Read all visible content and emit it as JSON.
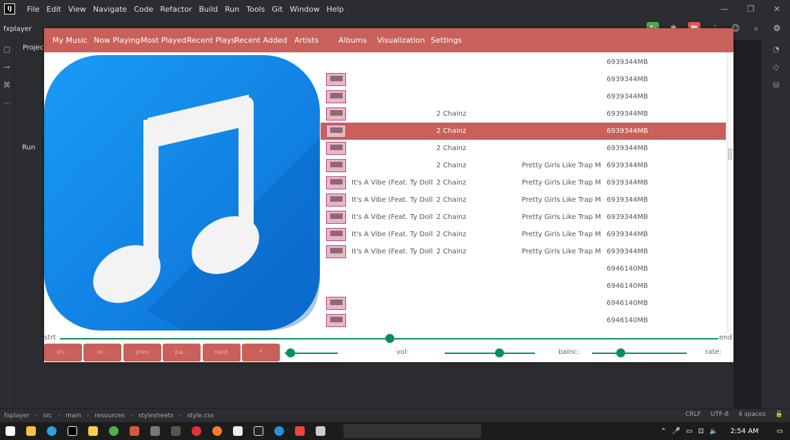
{
  "ide": {
    "logo": "IJ",
    "menu": [
      "File",
      "Edit",
      "View",
      "Navigate",
      "Code",
      "Refactor",
      "Build",
      "Run",
      "Tools",
      "Git",
      "Window",
      "Help"
    ],
    "project_name": "fxplayer",
    "project_panel_label": "Project",
    "run_panel_label": "Run",
    "breadcrumb": [
      "fxplayer",
      "src",
      "main",
      "resources",
      "stylesheets",
      "style.css"
    ],
    "status": {
      "line_sep": "CRLF",
      "encoding": "UTF-8",
      "indent": "4 spaces"
    }
  },
  "player": {
    "nav": [
      "My Music",
      "Now Playing",
      "Most Played",
      "Recent Plays",
      "Recent Added",
      "Artists",
      "Albums",
      "Visualization",
      "Settings"
    ],
    "rows": [
      {
        "thumb": false,
        "title": "",
        "artist": "",
        "album": "",
        "size": "6939344MB",
        "selected": false
      },
      {
        "thumb": true,
        "title": "",
        "artist": "",
        "album": "",
        "size": "6939344MB",
        "selected": false
      },
      {
        "thumb": true,
        "title": "",
        "artist": "",
        "album": "",
        "size": "6939344MB",
        "selected": false
      },
      {
        "thumb": true,
        "title": "",
        "artist": "2 Chainz",
        "album": "",
        "size": "6939344MB",
        "selected": false
      },
      {
        "thumb": true,
        "title": "",
        "artist": "2 Chainz",
        "album": "",
        "size": "6939344MB",
        "selected": true
      },
      {
        "thumb": true,
        "title": "",
        "artist": "2 Chainz",
        "album": "",
        "size": "6939344MB",
        "selected": false
      },
      {
        "thumb": true,
        "title": "",
        "artist": "2 Chainz",
        "album": "Pretty Girls Like Trap M...",
        "size": "6939344MB",
        "selected": false
      },
      {
        "thumb": true,
        "title": "It's A Vibe (Feat. Ty Doll...",
        "artist": "2 Chainz",
        "album": "Pretty Girls Like Trap M...",
        "size": "6939344MB",
        "selected": false
      },
      {
        "thumb": true,
        "title": "It's A Vibe (Feat. Ty Doll...",
        "artist": "2 Chainz",
        "album": "Pretty Girls Like Trap M...",
        "size": "6939344MB",
        "selected": false
      },
      {
        "thumb": true,
        "title": "It's A Vibe (Feat. Ty Doll...",
        "artist": "2 Chainz",
        "album": "Pretty Girls Like Trap M...",
        "size": "6939344MB",
        "selected": false
      },
      {
        "thumb": true,
        "title": "It's A Vibe (Feat. Ty Doll...",
        "artist": "2 Chainz",
        "album": "Pretty Girls Like Trap M...",
        "size": "6939344MB",
        "selected": false
      },
      {
        "thumb": true,
        "title": "It's A Vibe (Feat. Ty Doll...",
        "artist": "2 Chainz",
        "album": "Pretty Girls Like Trap M...",
        "size": "6939344MB",
        "selected": false
      },
      {
        "thumb": false,
        "title": "",
        "artist": "",
        "album": "",
        "size": "6946140MB",
        "selected": false
      },
      {
        "thumb": false,
        "title": "",
        "artist": "",
        "album": "",
        "size": "6946140MB",
        "selected": false
      },
      {
        "thumb": true,
        "title": "",
        "artist": "",
        "album": "",
        "size": "6946140MB",
        "selected": false
      },
      {
        "thumb": true,
        "title": "",
        "artist": "",
        "album": "",
        "size": "6946140MB",
        "selected": false
      }
    ],
    "progress": {
      "start_label": "strt",
      "end_label": "end",
      "value": 0.5
    },
    "buttons": [
      "sh...",
      "re...",
      "prev",
      "pa...",
      "next",
      "*"
    ],
    "seek_value": 0.1,
    "volume_label": "vol:",
    "volume_value": 0.6,
    "balance_label": "balnc:",
    "balance_value": 0.3,
    "rate_label": "rate:"
  },
  "taskbar": {
    "time": "2:54 AM"
  },
  "colors": {
    "accent": "#c9605a",
    "slider": "#0a8f5a",
    "artwork_blue": "#1a8ff0"
  }
}
